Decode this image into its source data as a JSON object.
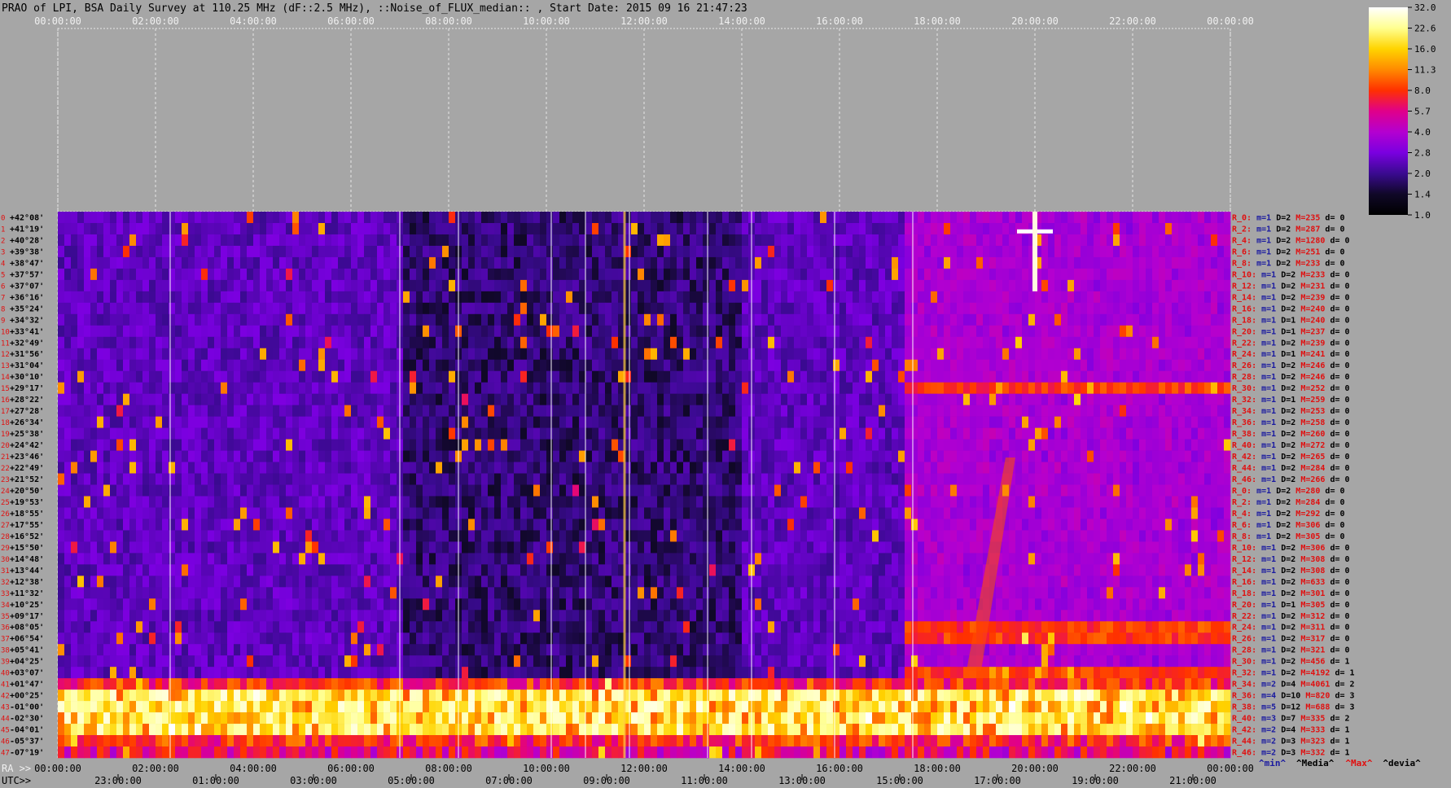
{
  "title": "PRAO of LPI, BSA Daily Survey at 110.25 MHz (dF::2.5 MHz), ::Noise_of_FLUX_median:: , Start Date: 2015 09 16 21:47:23",
  "top_time_labels": [
    "00:00:00",
    "02:00:00",
    "04:00:00",
    "06:00:00",
    "08:00:00",
    "10:00:00",
    "12:00:00",
    "14:00:00",
    "16:00:00",
    "18:00:00",
    "20:00:00",
    "22:00:00",
    "00:00:00"
  ],
  "ra_axis_label": "RA >>",
  "ra_time_labels": [
    "00:00:00",
    "02:00:00",
    "04:00:00",
    "06:00:00",
    "08:00:00",
    "10:00:00",
    "12:00:00",
    "14:00:00",
    "16:00:00",
    "18:00:00",
    "20:00:00",
    "22:00:00",
    "00:00:00"
  ],
  "utc_axis_label": "UTC>>",
  "utc_time_labels": [
    "23:00:00",
    "01:00:00",
    "03:00:00",
    "05:00:00",
    "07:00:00",
    "09:00:00",
    "11:00:00",
    "13:00:00",
    "15:00:00",
    "17:00:00",
    "19:00:00",
    "21:00:00"
  ],
  "colorbar": {
    "ticks": [
      "32.0",
      "22.6",
      "16.0",
      "11.3",
      "8.0",
      "5.7",
      "4.0",
      "2.8",
      "2.0",
      "1.4",
      "1.0"
    ],
    "stops": [
      "#ffffff",
      "#ffff90",
      "#ffd400",
      "#ff8a00",
      "#ff3000",
      "#e0008a",
      "#b400d0",
      "#7a00e0",
      "#3a0a90",
      "#100828",
      "#000000"
    ]
  },
  "footer_legend": [
    {
      "text": "^min^",
      "color": "#1a1aa0"
    },
    {
      "text": "^Media^",
      "color": "#000000"
    },
    {
      "text": "^Max^",
      "color": "#e01010"
    },
    {
      "text": "^devia^",
      "color": "#000000"
    }
  ],
  "chart_data": {
    "type": "heatmap",
    "title": "PRAO of LPI, BSA Daily Survey at 110.25 MHz (dF::2.5 MHz), ::Noise_of_FLUX_median:: , Start Date: 2015 09 16 21:47:23",
    "xlabel": "RA >>",
    "x_secondary_label": "UTC>>",
    "x_range_hours": [
      0,
      24
    ],
    "color_scale": "log",
    "color_range": [
      1.0,
      32.0
    ],
    "declinations": [
      "+42°08'",
      "+41°19'",
      "+40°28'",
      "+39°38'",
      "+38°47'",
      "+37°57'",
      "+37°07'",
      "+36°16'",
      "+35°24'",
      "+34°32'",
      "+33°41'",
      "+32°49'",
      "+31°56'",
      "+31°04'",
      "+30°10'",
      "+29°17'",
      "+28°22'",
      "+27°28'",
      "+26°34'",
      "+25°38'",
      "+24°42'",
      "+23°46'",
      "+22°49'",
      "+21°52'",
      "+20°50'",
      "+19°53'",
      "+18°55'",
      "+17°55'",
      "+16°52'",
      "+15°50'",
      "+14°48'",
      "+13°44'",
      "+12°38'",
      "+11°32'",
      "+10°25'",
      "+09°17'",
      "+08°05'",
      "+06°54'",
      "+05°41'",
      "+04°25'",
      "+03°07'",
      "+01°47'",
      "+00°25'",
      "-01°00'",
      "-02°30'",
      "-04°01'",
      "-05°37'",
      "-07°19'"
    ],
    "row_stats": [
      {
        "r": "R_0:",
        "min": "m=1",
        "d": "D=2",
        "max": "M=235",
        "dev": "d= 0"
      },
      {
        "r": "R_2:",
        "min": "m=1",
        "d": "D=2",
        "max": "M=287",
        "dev": "d= 0"
      },
      {
        "r": "R_4:",
        "min": "m=1",
        "d": "D=2",
        "max": "M=1280",
        "dev": "d= 0"
      },
      {
        "r": "R_6:",
        "min": "m=1",
        "d": "D=2",
        "max": "M=251",
        "dev": "d= 0"
      },
      {
        "r": "R_8:",
        "min": "m=1",
        "d": "D=2",
        "max": "M=233",
        "dev": "d= 0"
      },
      {
        "r": "R_10:",
        "min": "m=1",
        "d": "D=2",
        "max": "M=233",
        "dev": "d= 0"
      },
      {
        "r": "R_12:",
        "min": "m=1",
        "d": "D=2",
        "max": "M=231",
        "dev": "d= 0"
      },
      {
        "r": "R_14:",
        "min": "m=1",
        "d": "D=2",
        "max": "M=239",
        "dev": "d= 0"
      },
      {
        "r": "R_16:",
        "min": "m=1",
        "d": "D=2",
        "max": "M=240",
        "dev": "d= 0"
      },
      {
        "r": "R_18:",
        "min": "m=1",
        "d": "D=1",
        "max": "M=240",
        "dev": "d= 0"
      },
      {
        "r": "R_20:",
        "min": "m=1",
        "d": "D=1",
        "max": "M=237",
        "dev": "d= 0"
      },
      {
        "r": "R_22:",
        "min": "m=1",
        "d": "D=2",
        "max": "M=239",
        "dev": "d= 0"
      },
      {
        "r": "R_24:",
        "min": "m=1",
        "d": "D=1",
        "max": "M=241",
        "dev": "d= 0"
      },
      {
        "r": "R_26:",
        "min": "m=1",
        "d": "D=2",
        "max": "M=246",
        "dev": "d= 0"
      },
      {
        "r": "R_28:",
        "min": "m=1",
        "d": "D=2",
        "max": "M=246",
        "dev": "d= 0"
      },
      {
        "r": "R_30:",
        "min": "m=1",
        "d": "D=2",
        "max": "M=252",
        "dev": "d= 0"
      },
      {
        "r": "R_32:",
        "min": "m=1",
        "d": "D=1",
        "max": "M=259",
        "dev": "d= 0"
      },
      {
        "r": "R_34:",
        "min": "m=1",
        "d": "D=2",
        "max": "M=253",
        "dev": "d= 0"
      },
      {
        "r": "R_36:",
        "min": "m=1",
        "d": "D=2",
        "max": "M=258",
        "dev": "d= 0"
      },
      {
        "r": "R_38:",
        "min": "m=1",
        "d": "D=2",
        "max": "M=260",
        "dev": "d= 0"
      },
      {
        "r": "R_40:",
        "min": "m=1",
        "d": "D=2",
        "max": "M=272",
        "dev": "d= 0"
      },
      {
        "r": "R_42:",
        "min": "m=1",
        "d": "D=2",
        "max": "M=265",
        "dev": "d= 0"
      },
      {
        "r": "R_44:",
        "min": "m=1",
        "d": "D=2",
        "max": "M=284",
        "dev": "d= 0"
      },
      {
        "r": "R_46:",
        "min": "m=1",
        "d": "D=2",
        "max": "M=266",
        "dev": "d= 0"
      },
      {
        "r": "R_0:",
        "min": "m=1",
        "d": "D=2",
        "max": "M=280",
        "dev": "d= 0"
      },
      {
        "r": "R_2:",
        "min": "m=1",
        "d": "D=2",
        "max": "M=284",
        "dev": "d= 0"
      },
      {
        "r": "R_4:",
        "min": "m=1",
        "d": "D=2",
        "max": "M=292",
        "dev": "d= 0"
      },
      {
        "r": "R_6:",
        "min": "m=1",
        "d": "D=2",
        "max": "M=306",
        "dev": "d= 0"
      },
      {
        "r": "R_8:",
        "min": "m=1",
        "d": "D=2",
        "max": "M=305",
        "dev": "d= 0"
      },
      {
        "r": "R_10:",
        "min": "m=1",
        "d": "D=2",
        "max": "M=306",
        "dev": "d= 0"
      },
      {
        "r": "R_12:",
        "min": "m=1",
        "d": "D=2",
        "max": "M=308",
        "dev": "d= 0"
      },
      {
        "r": "R_14:",
        "min": "m=1",
        "d": "D=2",
        "max": "M=308",
        "dev": "d= 0"
      },
      {
        "r": "R_16:",
        "min": "m=1",
        "d": "D=2",
        "max": "M=633",
        "dev": "d= 0"
      },
      {
        "r": "R_18:",
        "min": "m=1",
        "d": "D=2",
        "max": "M=301",
        "dev": "d= 0"
      },
      {
        "r": "R_20:",
        "min": "m=1",
        "d": "D=1",
        "max": "M=305",
        "dev": "d= 0"
      },
      {
        "r": "R_22:",
        "min": "m=1",
        "d": "D=2",
        "max": "M=312",
        "dev": "d= 0"
      },
      {
        "r": "R_24:",
        "min": "m=1",
        "d": "D=2",
        "max": "M=311",
        "dev": "d= 0"
      },
      {
        "r": "R_26:",
        "min": "m=1",
        "d": "D=2",
        "max": "M=317",
        "dev": "d= 0"
      },
      {
        "r": "R_28:",
        "min": "m=1",
        "d": "D=2",
        "max": "M=321",
        "dev": "d= 0"
      },
      {
        "r": "R_30:",
        "min": "m=1",
        "d": "D=2",
        "max": "M=456",
        "dev": "d= 1"
      },
      {
        "r": "R_32:",
        "min": "m=1",
        "d": "D=2",
        "max": "M=4192",
        "dev": "d= 1"
      },
      {
        "r": "R_34:",
        "min": "m=2",
        "d": "D=4",
        "max": "M=4061",
        "dev": "d= 2"
      },
      {
        "r": "R_36:",
        "min": "m=4",
        "d": "D=10",
        "max": "M=820",
        "dev": "d= 3"
      },
      {
        "r": "R_38:",
        "min": "m=5",
        "d": "D=12",
        "max": "M=688",
        "dev": "d= 3"
      },
      {
        "r": "R_40:",
        "min": "m=3",
        "d": "D=7",
        "max": "M=335",
        "dev": "d= 2"
      },
      {
        "r": "R_42:",
        "min": "m=2",
        "d": "D=4",
        "max": "M=333",
        "dev": "d= 1"
      },
      {
        "r": "R_44:",
        "min": "m=2",
        "d": "D=3",
        "max": "M=323",
        "dev": "d= 1"
      },
      {
        "r": "R_46:",
        "min": "m=2",
        "d": "D=3",
        "max": "M=332",
        "dev": "d= 1"
      }
    ]
  }
}
